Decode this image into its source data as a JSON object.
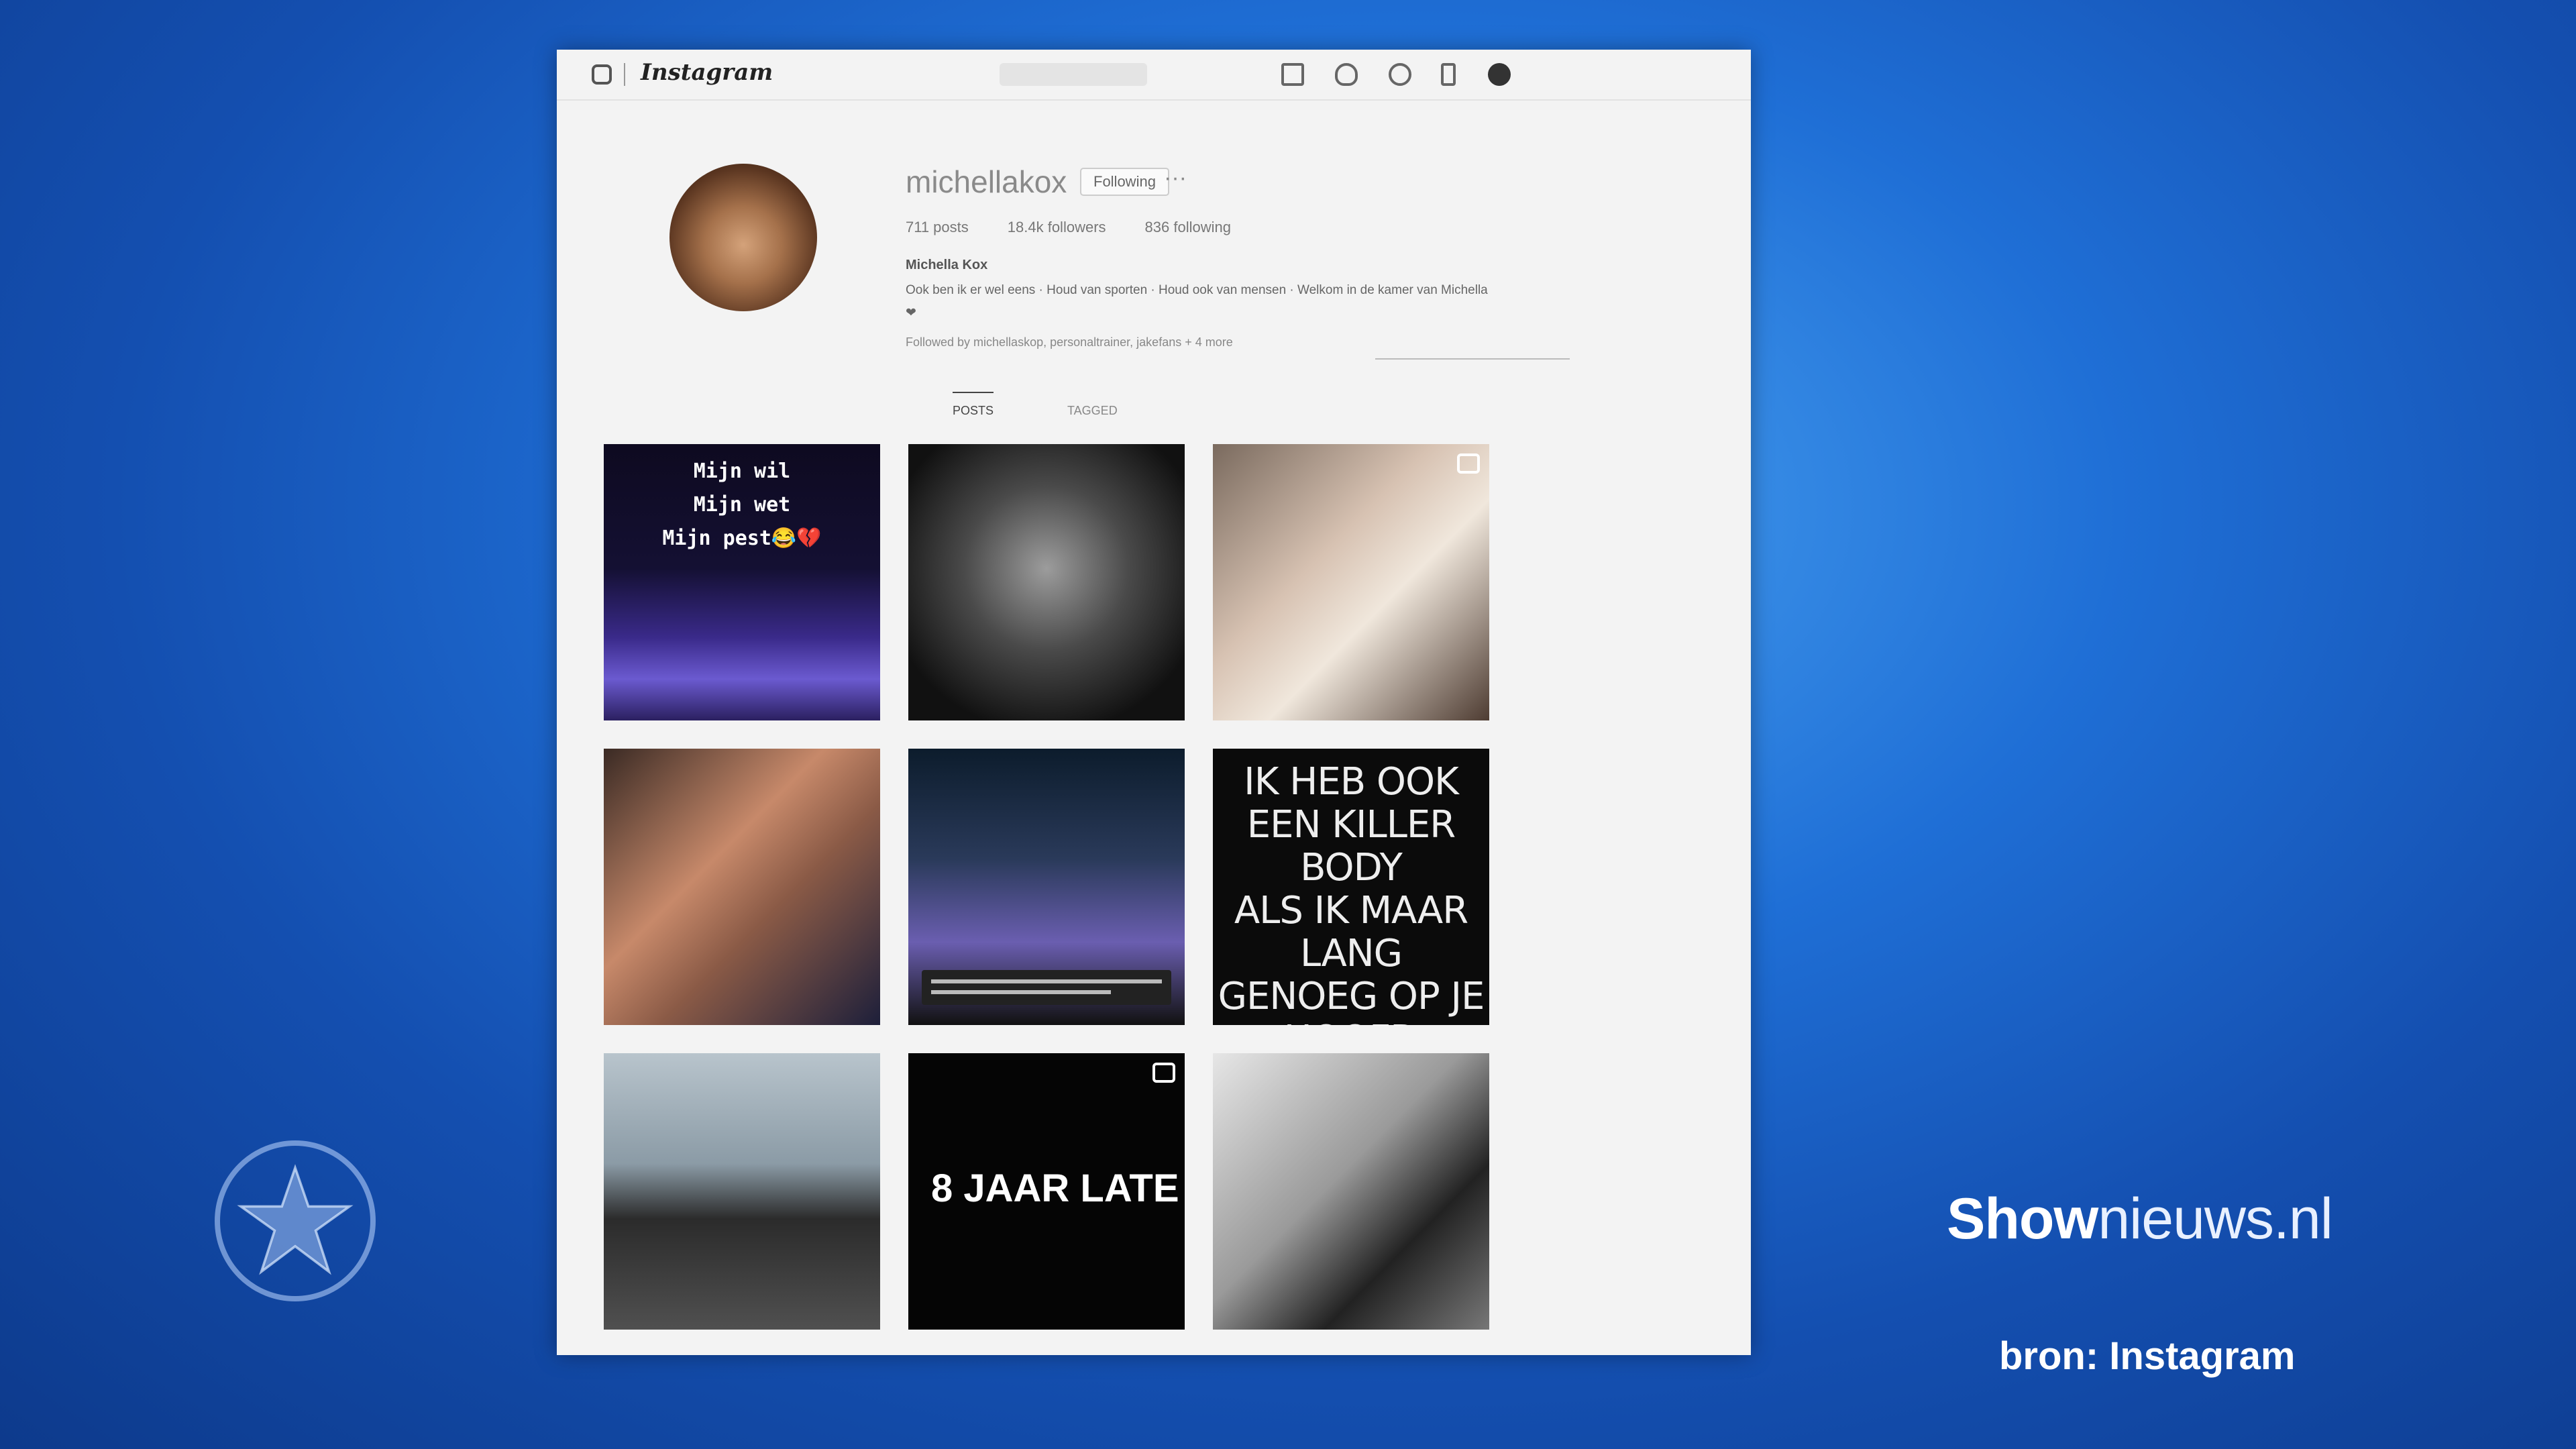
{
  "app": {
    "title": "Instagram",
    "search_placeholder": ""
  },
  "profile": {
    "username": "michellakox",
    "follow_label": "Following",
    "more_label": "···",
    "stats": [
      "711 posts",
      "18.4k followers",
      "836 following"
    ],
    "display_name": "Michella Kox",
    "bio": "Ook ben ik er wel eens · Houd van sporten · Houd ook van mensen · Welkom in de kamer van Michella ❤",
    "followed_by": "Followed by michellaskop, personaltrainer, jakefans + 4 more",
    "tabs": [
      {
        "label": "POSTS",
        "active": true
      },
      {
        "label": "TAGGED",
        "active": false
      }
    ]
  },
  "posts": [
    {
      "text": "Mijn wil\nMijn wet\nMijn pest😂💔",
      "has_badge": false
    },
    {
      "text": "",
      "has_badge": false
    },
    {
      "text": "",
      "has_badge": true
    },
    {
      "text": "",
      "has_badge": false
    },
    {
      "text": "",
      "has_badge": false
    },
    {
      "text": "IK HEB OOK\nEEN KILLER BODY\nALS IK MAAR LANG\nGENOEG OP JE HOOFD\nBLIJF ZITTEN\nGA JE DOOD",
      "has_badge": false
    },
    {
      "text": "",
      "has_badge": false
    },
    {
      "text": "8 JAAR LATE",
      "has_badge": true
    },
    {
      "text": "",
      "has_badge": false
    }
  ],
  "overlay": {
    "brand_bold": "Show",
    "brand_light": "nieuws.nl",
    "source": "bron: Instagram",
    "logo_icon": "star-emblem-icon"
  }
}
